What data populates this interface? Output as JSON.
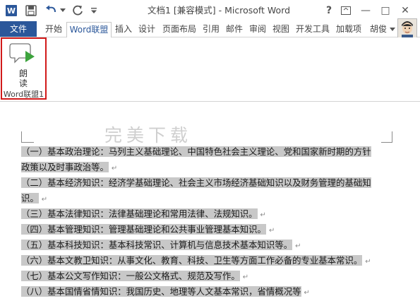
{
  "window": {
    "title": "文档1 [兼容模式] - Microsoft Word",
    "help": "?",
    "minimize": "—",
    "maximize": "□",
    "close": "✕"
  },
  "quick_access": {
    "app_icon_letter": "W"
  },
  "tabs": {
    "file": "文件",
    "items": [
      "开始",
      "Word联盟",
      "插入",
      "设计",
      "页面布局",
      "引用",
      "邮件",
      "审阅",
      "视图",
      "开发工具",
      "加载项"
    ],
    "active": "Word联盟",
    "user": "胡俊"
  },
  "ribbon": {
    "read_button_label": "朗读",
    "group_label": "Word联盟1"
  },
  "document": {
    "watermark": "完美下载",
    "lines": [
      {
        "text": "（一）基本政治理论：马列主义基础理论、中国特色社会主义理论、党和国家新时期的方针",
        "mark": false
      },
      {
        "text": "政策以及时事政治等。",
        "mark": true
      },
      {
        "text": "（二）基本经济知识：经济学基础理论、社会主义市场经济基础知识以及财务管理的基础知",
        "mark": false
      },
      {
        "text": "识。",
        "mark": true
      },
      {
        "text": "（三）基本法律知识：法律基础理论和常用法律、法规知识。",
        "mark": true
      },
      {
        "text": "（四）基本管理知识：管理基础理论和公共事业管理基本知识。",
        "mark": true
      },
      {
        "text": "（五）基本科技知识：基本科技常识、计算机与信息技术基本知识等。",
        "mark": true
      },
      {
        "text": "（六）基本文教卫知识：从事文化、教育、科技、卫生等方面工作必备的专业基本常识。",
        "mark": true
      },
      {
        "text": "（七）基本公文写作知识：一般公文格式、规范及写作。",
        "mark": true
      },
      {
        "text": "（八）基本国情省情知识：我国历史、地理等人文基本常识，省情概况等",
        "mark": true
      }
    ],
    "paragraph_mark": "↵"
  },
  "colors": {
    "accent": "#2b579a",
    "highlight": "#c8c8c8",
    "group_outline": "#d11a1a"
  }
}
